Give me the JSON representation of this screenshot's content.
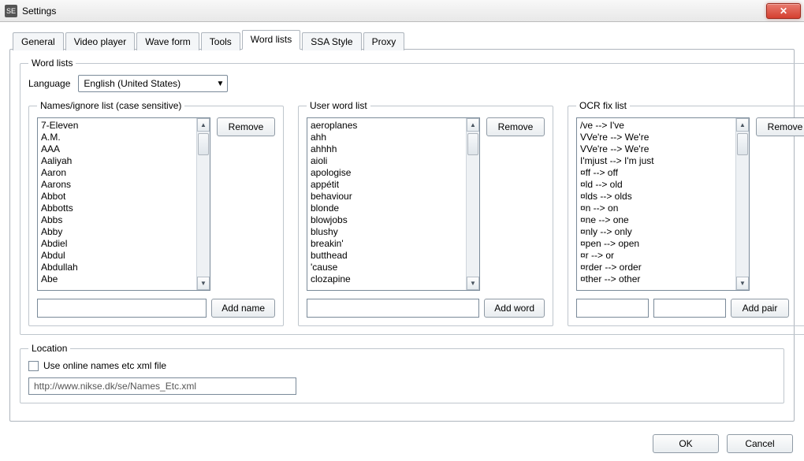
{
  "window": {
    "title": "Settings",
    "icon_label": "SE"
  },
  "tabs": [
    "General",
    "Video player",
    "Wave form",
    "Tools",
    "Word lists",
    "SSA Style",
    "Proxy"
  ],
  "active_tab_index": 4,
  "wordlists": {
    "group_label": "Word lists",
    "language_label": "Language",
    "language_value": "English (United States)",
    "names_group_label": "Names/ignore list (case sensitive)",
    "userwords_group_label": "User word list",
    "ocrfix_group_label": "OCR fix list",
    "remove_label": "Remove",
    "add_name_label": "Add name",
    "add_word_label": "Add word",
    "add_pair_label": "Add pair",
    "names_list": [
      "7-Eleven",
      "A.M.",
      "AAA",
      "Aaliyah",
      "Aaron",
      "Aarons",
      "Abbot",
      "Abbotts",
      "Abbs",
      "Abby",
      "Abdiel",
      "Abdul",
      "Abdullah",
      "Abe"
    ],
    "user_word_list": [
      "aeroplanes",
      "ahh",
      "ahhhh",
      "aioli",
      "apologise",
      "appétit",
      "behaviour",
      "blonde",
      "blowjobs",
      "blushy",
      "breakin'",
      "butthead",
      "'cause",
      "clozapine"
    ],
    "ocr_fix_list": [
      "/ve --> I've",
      "VVe're --> We're",
      "VVe're --> We're",
      "I'mjust --> I'm just",
      "¤ff --> off",
      "¤ld --> old",
      "¤lds --> olds",
      "¤n --> on",
      "¤ne --> one",
      "¤nly --> only",
      "¤pen --> open",
      "¤r --> or",
      "¤rder --> order",
      "¤ther --> other"
    ]
  },
  "location": {
    "group_label": "Location",
    "checkbox_label": "Use online names etc xml file",
    "url": "http://www.nikse.dk/se/Names_Etc.xml"
  },
  "buttons": {
    "ok": "OK",
    "cancel": "Cancel"
  }
}
